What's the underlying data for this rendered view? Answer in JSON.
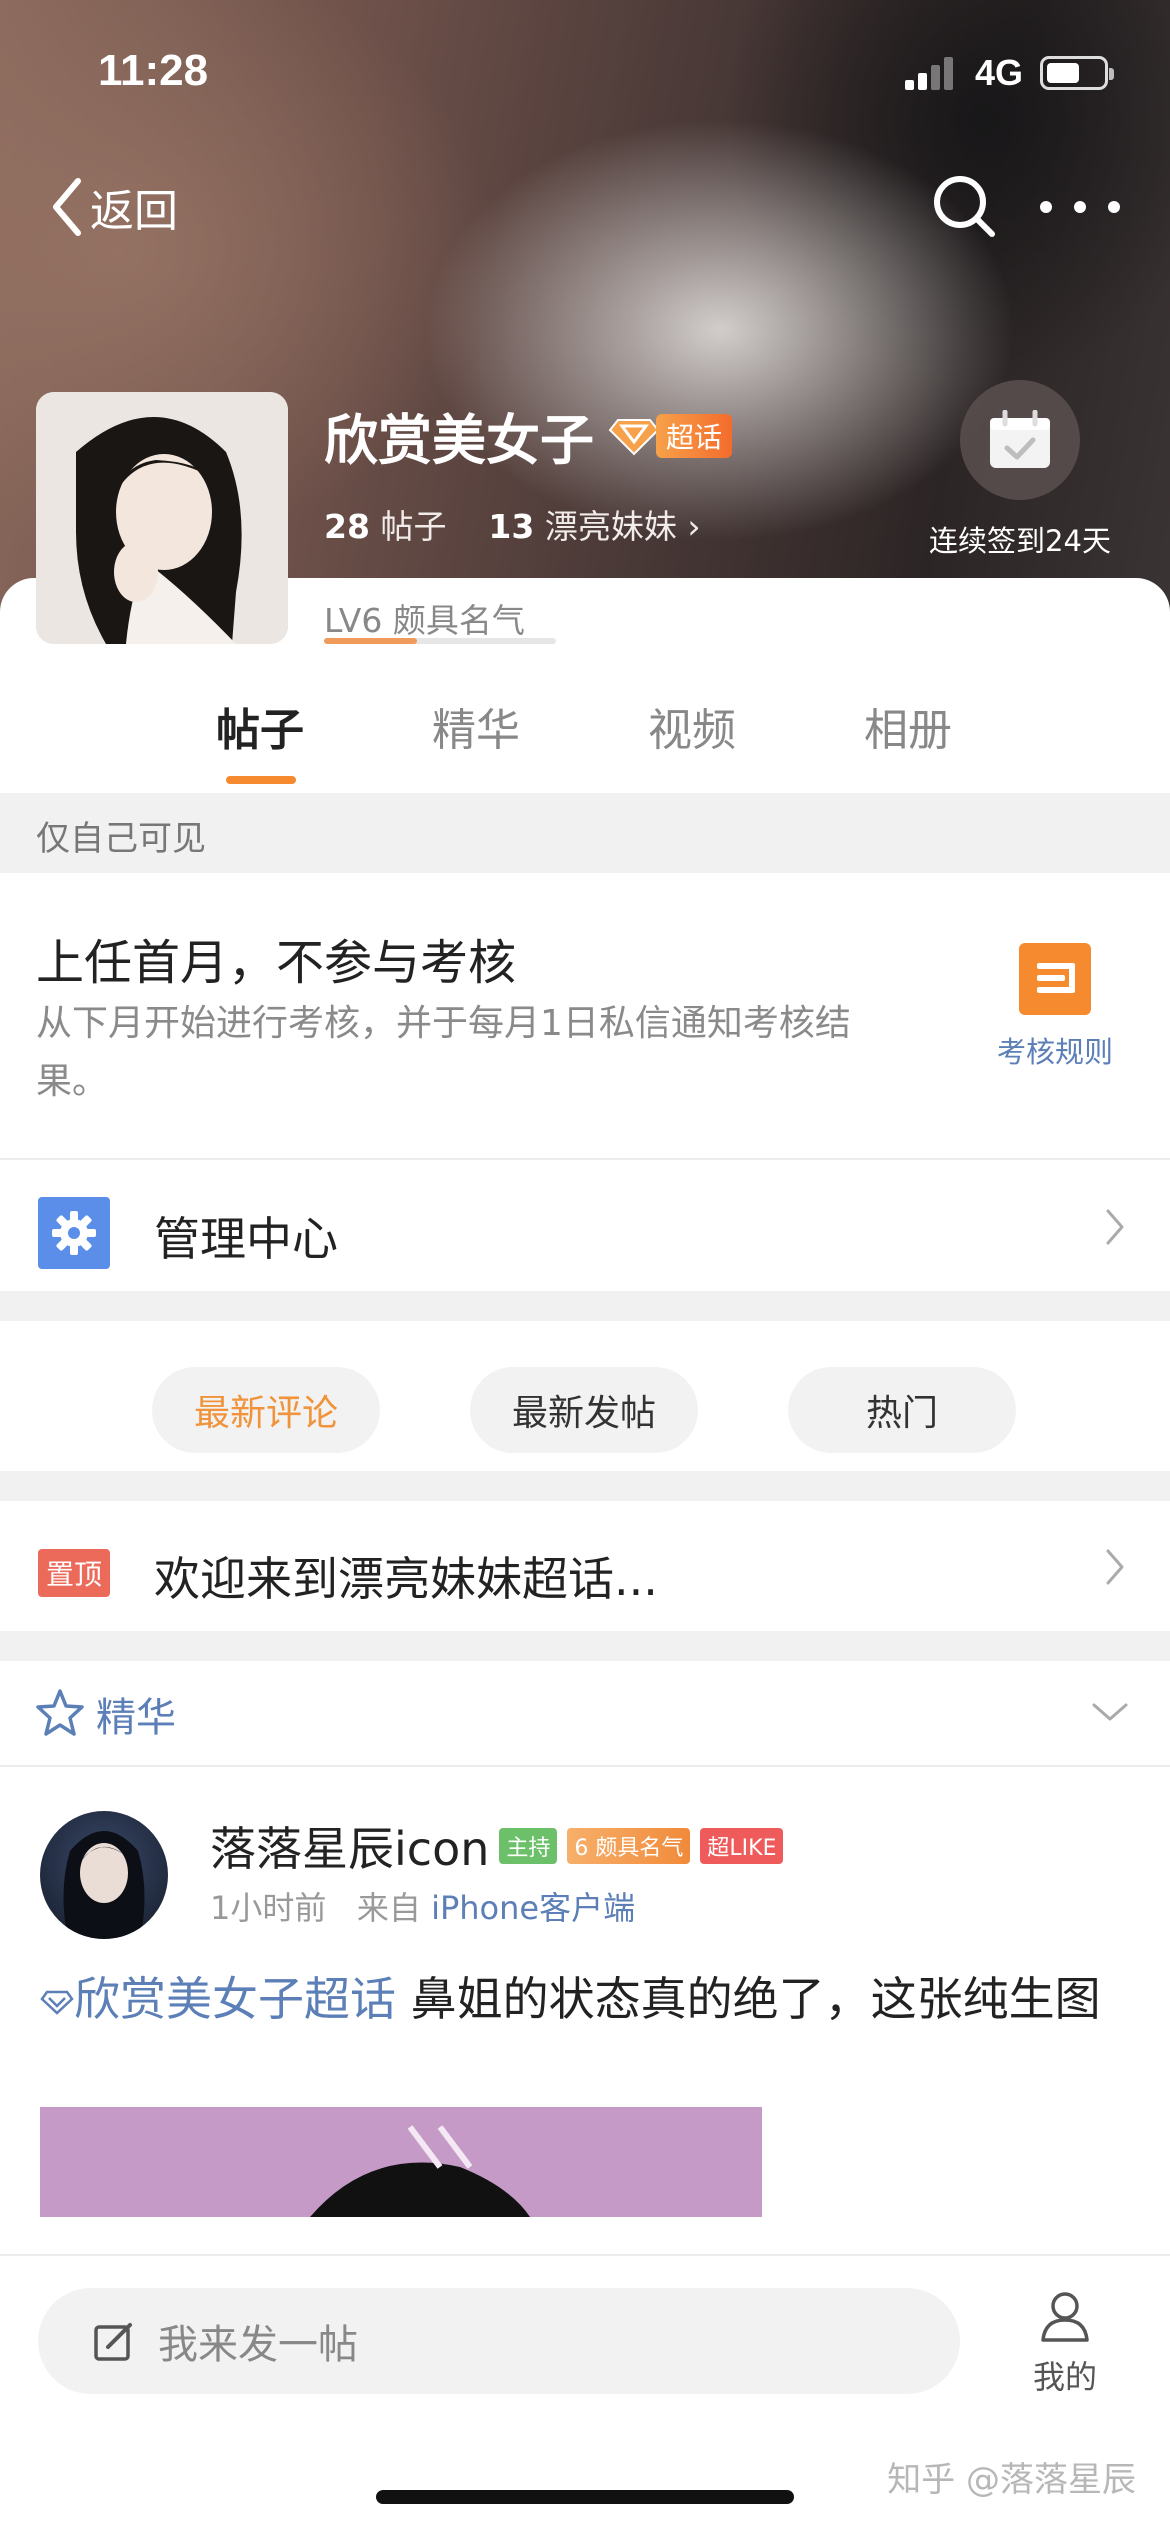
{
  "status": {
    "time": "11:28",
    "network": "4G"
  },
  "nav": {
    "back_label": "返回"
  },
  "topic": {
    "name": "欣赏美女子",
    "badge": "超话",
    "posts_count": "28",
    "posts_label": "帖子",
    "members_count": "13",
    "members_label": "漂亮妹妹",
    "checkin_label": "连续签到24天",
    "level": "LV6 颇具名气",
    "level_progress": 0.4
  },
  "tabs": [
    {
      "label": "帖子"
    },
    {
      "label": "精华"
    },
    {
      "label": "视频"
    },
    {
      "label": "相册"
    }
  ],
  "visibility_note": "仅自己可见",
  "notice": {
    "title": "上任首月，不参与考核",
    "desc": "从下月开始进行考核，并于每月1日私信通知考核结果。",
    "rule_label": "考核规则"
  },
  "manage": {
    "label": "管理中心"
  },
  "filters": [
    {
      "label": "最新评论"
    },
    {
      "label": "最新发帖"
    },
    {
      "label": "热门"
    }
  ],
  "pinned": {
    "tag": "置顶",
    "text": "欢迎来到漂亮妹妹超话..."
  },
  "featured": {
    "label": "精华"
  },
  "post": {
    "author": "落落星辰icon",
    "badges": {
      "host": "主持",
      "level": "颇具名气",
      "level_num": "6",
      "like": "超LIKE"
    },
    "time": "1小时前",
    "from_prefix": "来自",
    "source": "iPhone客户端",
    "topic": "欣赏美女子超话",
    "text": "鼻姐的状态真的绝了，这张纯生图"
  },
  "bottom": {
    "compose_placeholder": "我来发一帖",
    "mine_label": "我的",
    "watermark": "知乎 @落落星辰"
  },
  "colors": {
    "accent": "#f58a2f",
    "link": "#5b7fb6",
    "pin": "#ec6a5a",
    "manage": "#5b8ee8"
  }
}
